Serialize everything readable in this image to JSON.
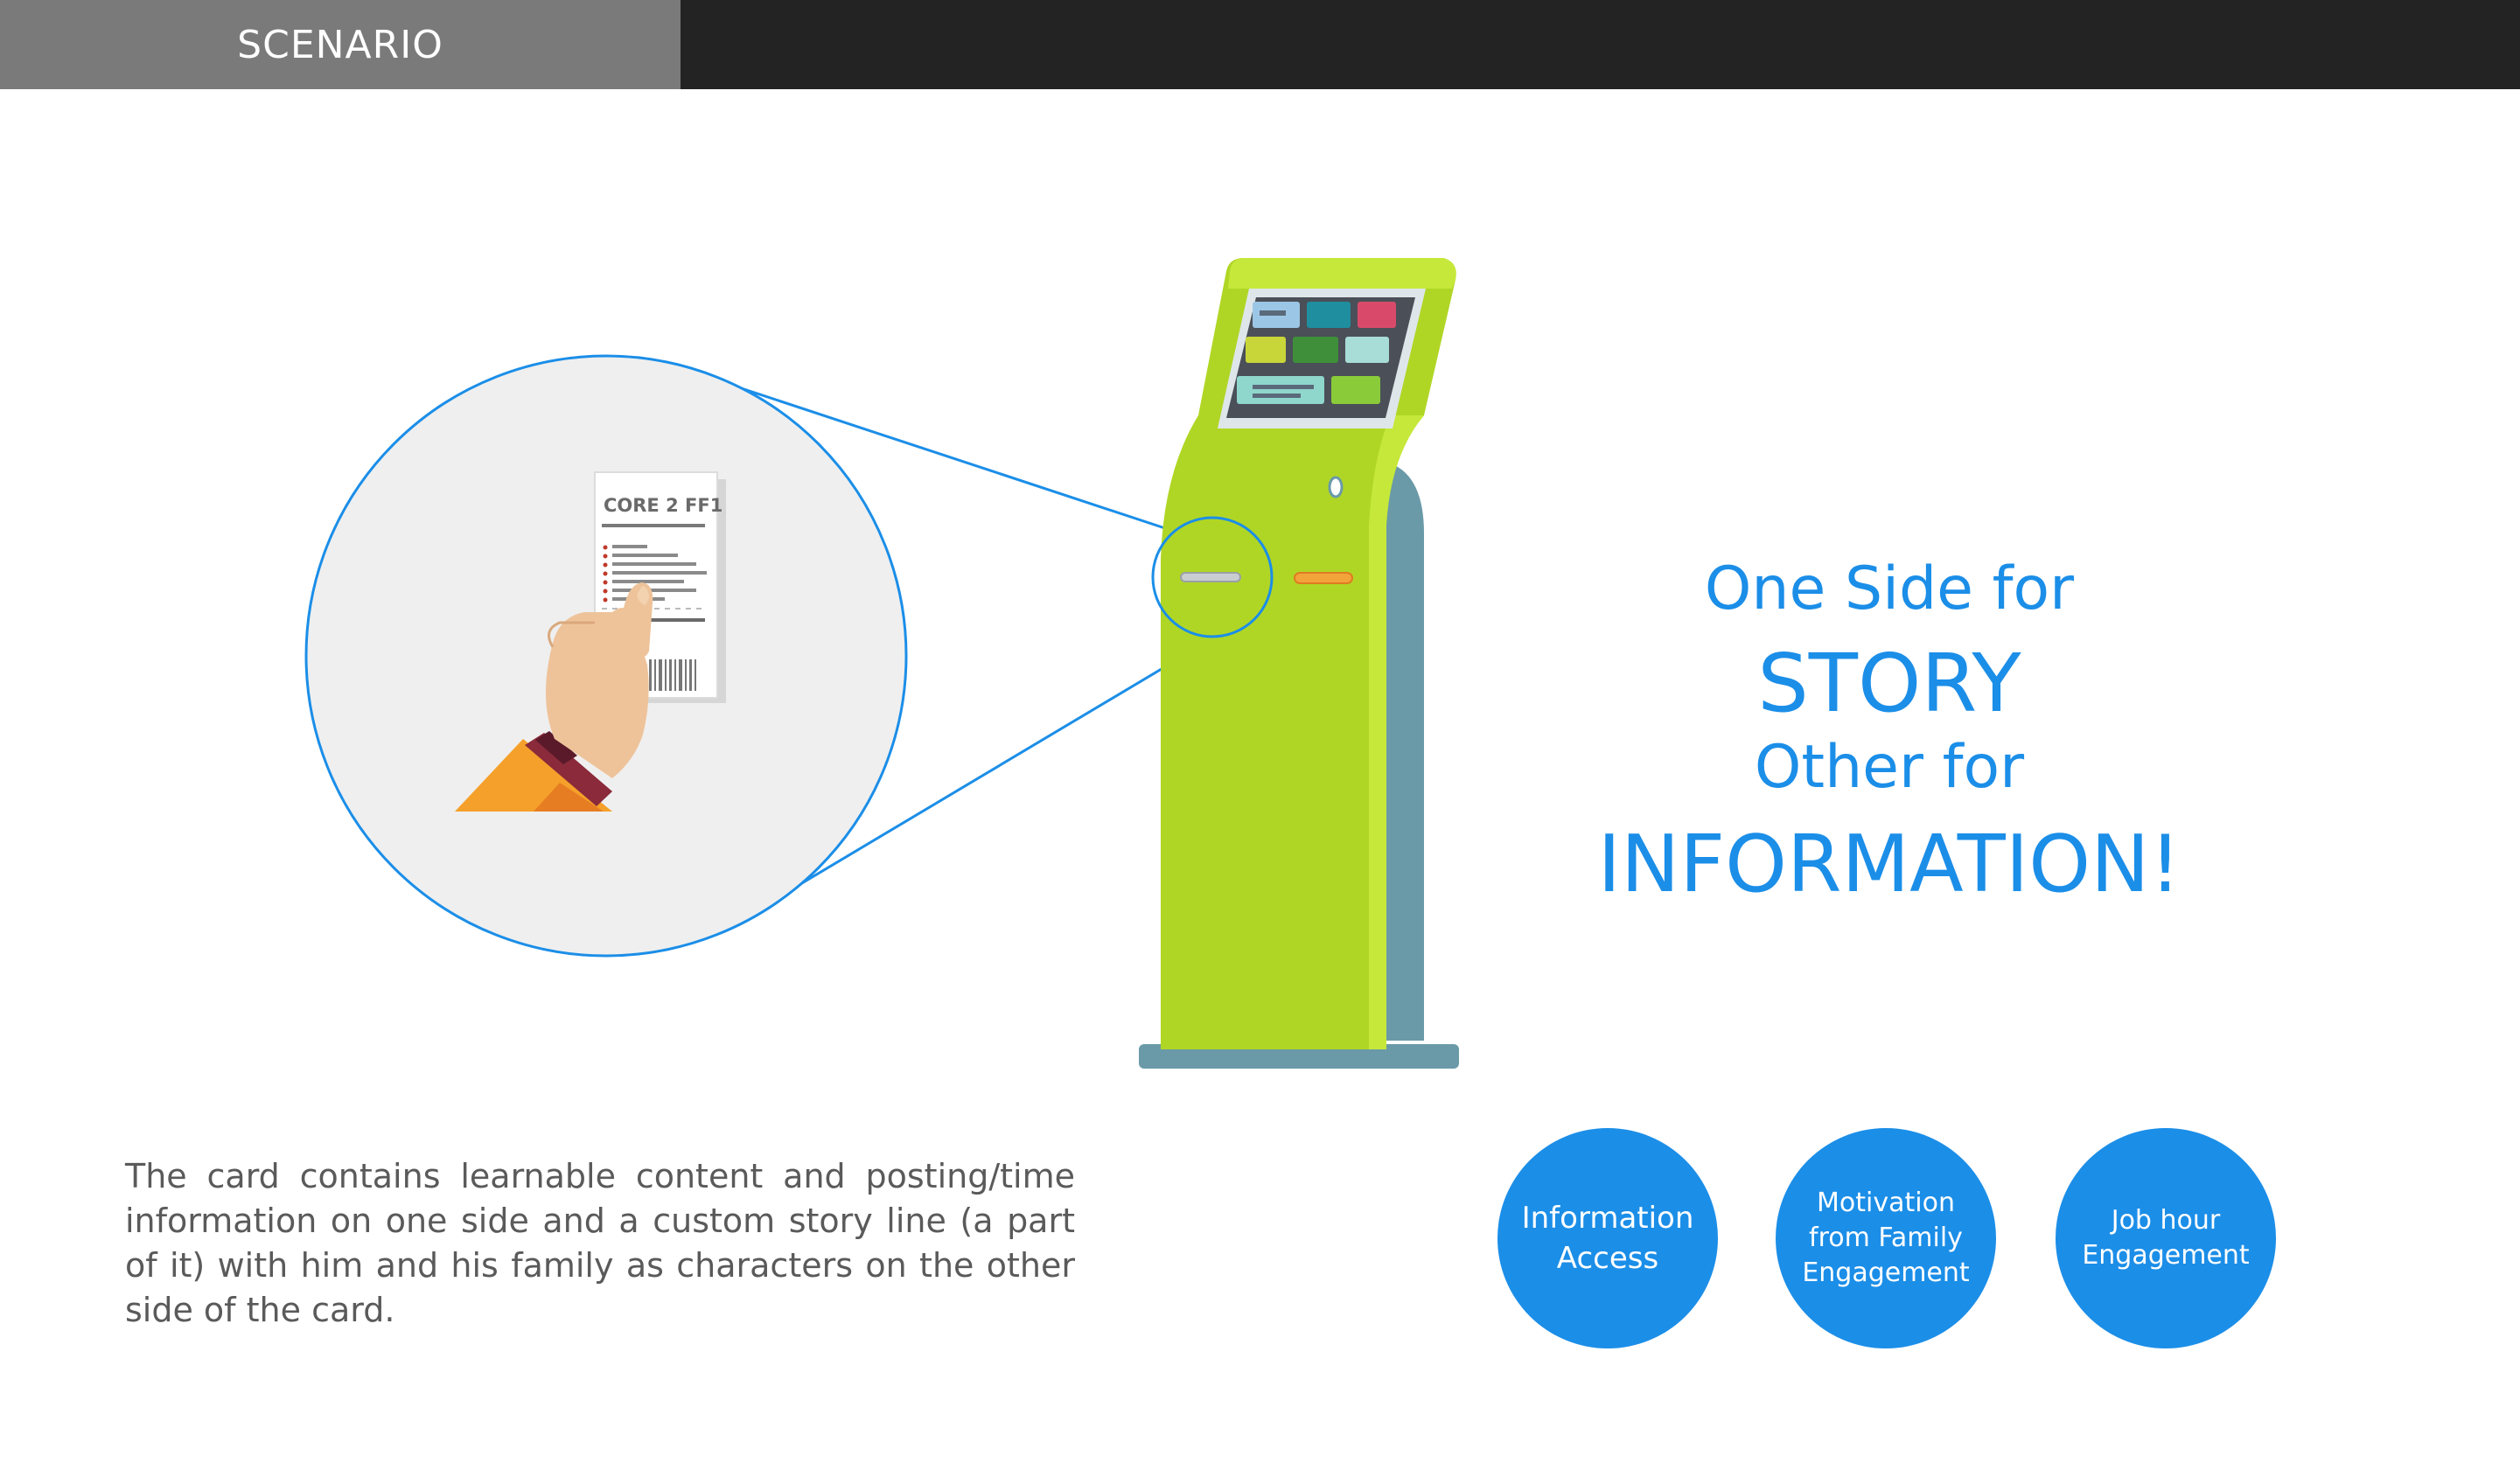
{
  "header": {
    "tab_label": "SCENARIO"
  },
  "card": {
    "title": "CORE 2 FF1"
  },
  "headline": {
    "line1": "One Side for",
    "line2": "STORY",
    "line3": "Other for",
    "line4": "INFORMATION!"
  },
  "description": "The card contains learnable content and posting/time information on one side and a custom story line (a part of it) with him and his family as characters on the other side of the card.",
  "benefits": [
    {
      "label": "Information\nAccess"
    },
    {
      "label": "Motivation\nfrom Family\nEngagement"
    },
    {
      "label": "Job hour\nEngagement"
    }
  ],
  "colors": {
    "accent_blue": "#1b8ee8",
    "header_dark": "#232323",
    "header_tab": "#7a7a7a",
    "kiosk_green": "#b0d625",
    "kiosk_stand": "#6a9aa8",
    "zoom_bg": "#efefef"
  }
}
